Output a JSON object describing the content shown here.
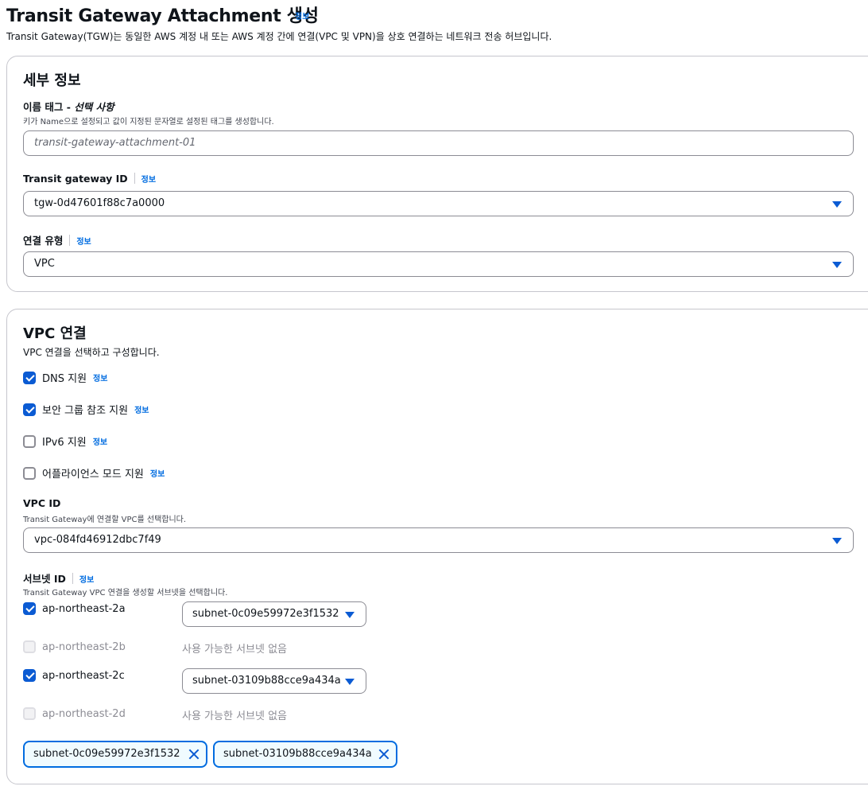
{
  "header": {
    "title": "Transit Gateway Attachment 생성",
    "info": "정보",
    "description": "Transit Gateway(TGW)는 동일한 AWS 계정 내 또는 AWS 계정 간에 연결(VPC 및 VPN)을 상호 연결하는 네트워크 전송 허브입니다."
  },
  "details": {
    "title": "세부 정보",
    "name_tag": {
      "label": "이름 태그 - ",
      "optional": "선택 사항",
      "hint": "키가 Name으로 설정되고 값이 지정된 문자열로 설정된 태그를 생성합니다.",
      "placeholder": "transit-gateway-attachment-01"
    },
    "tgw_id": {
      "label": "Transit gateway ID",
      "info": "정보",
      "value": "tgw-0d47601f88c7a0000"
    },
    "attachment_type": {
      "label": "연결 유형",
      "info": "정보",
      "value": "VPC"
    }
  },
  "vpc": {
    "title": "VPC 연결",
    "description": "VPC 연결을 선택하고 구성합니다.",
    "options": [
      {
        "label": "DNS 지원",
        "info": "정보",
        "checked": true
      },
      {
        "label": "보안 그룹 참조 지원",
        "info": "정보",
        "checked": true
      },
      {
        "label": "IPv6 지원",
        "info": "정보",
        "checked": false
      },
      {
        "label": "어플라이언스 모드 지원",
        "info": "정보",
        "checked": false
      }
    ],
    "vpc_id": {
      "label": "VPC ID",
      "hint": "Transit Gateway에 연결할 VPC를 선택합니다.",
      "value": "vpc-084fd46912dbc7f49"
    },
    "subnets": {
      "label": "서브넷 ID",
      "info": "정보",
      "hint": "Transit Gateway VPC 연결을 생성할 서브넷을 선택합니다.",
      "zones": [
        {
          "az": "ap-northeast-2a",
          "checked": true,
          "subnet": "subnet-0c09e59972e3f1532"
        },
        {
          "az": "ap-northeast-2b",
          "checked": false,
          "disabled": true,
          "none_text": "사용 가능한 서브넷 없음"
        },
        {
          "az": "ap-northeast-2c",
          "checked": true,
          "subnet": "subnet-03109b88cce9a434a"
        },
        {
          "az": "ap-northeast-2d",
          "checked": false,
          "disabled": true,
          "none_text": "사용 가능한 서브넷 없음"
        }
      ],
      "tokens": [
        "subnet-0c09e59972e3f1532",
        "subnet-03109b88cce9a434a"
      ]
    }
  },
  "colors": {
    "accent": "#0b5bd3",
    "link": "#006ce0",
    "border": "#c6c6cd"
  }
}
